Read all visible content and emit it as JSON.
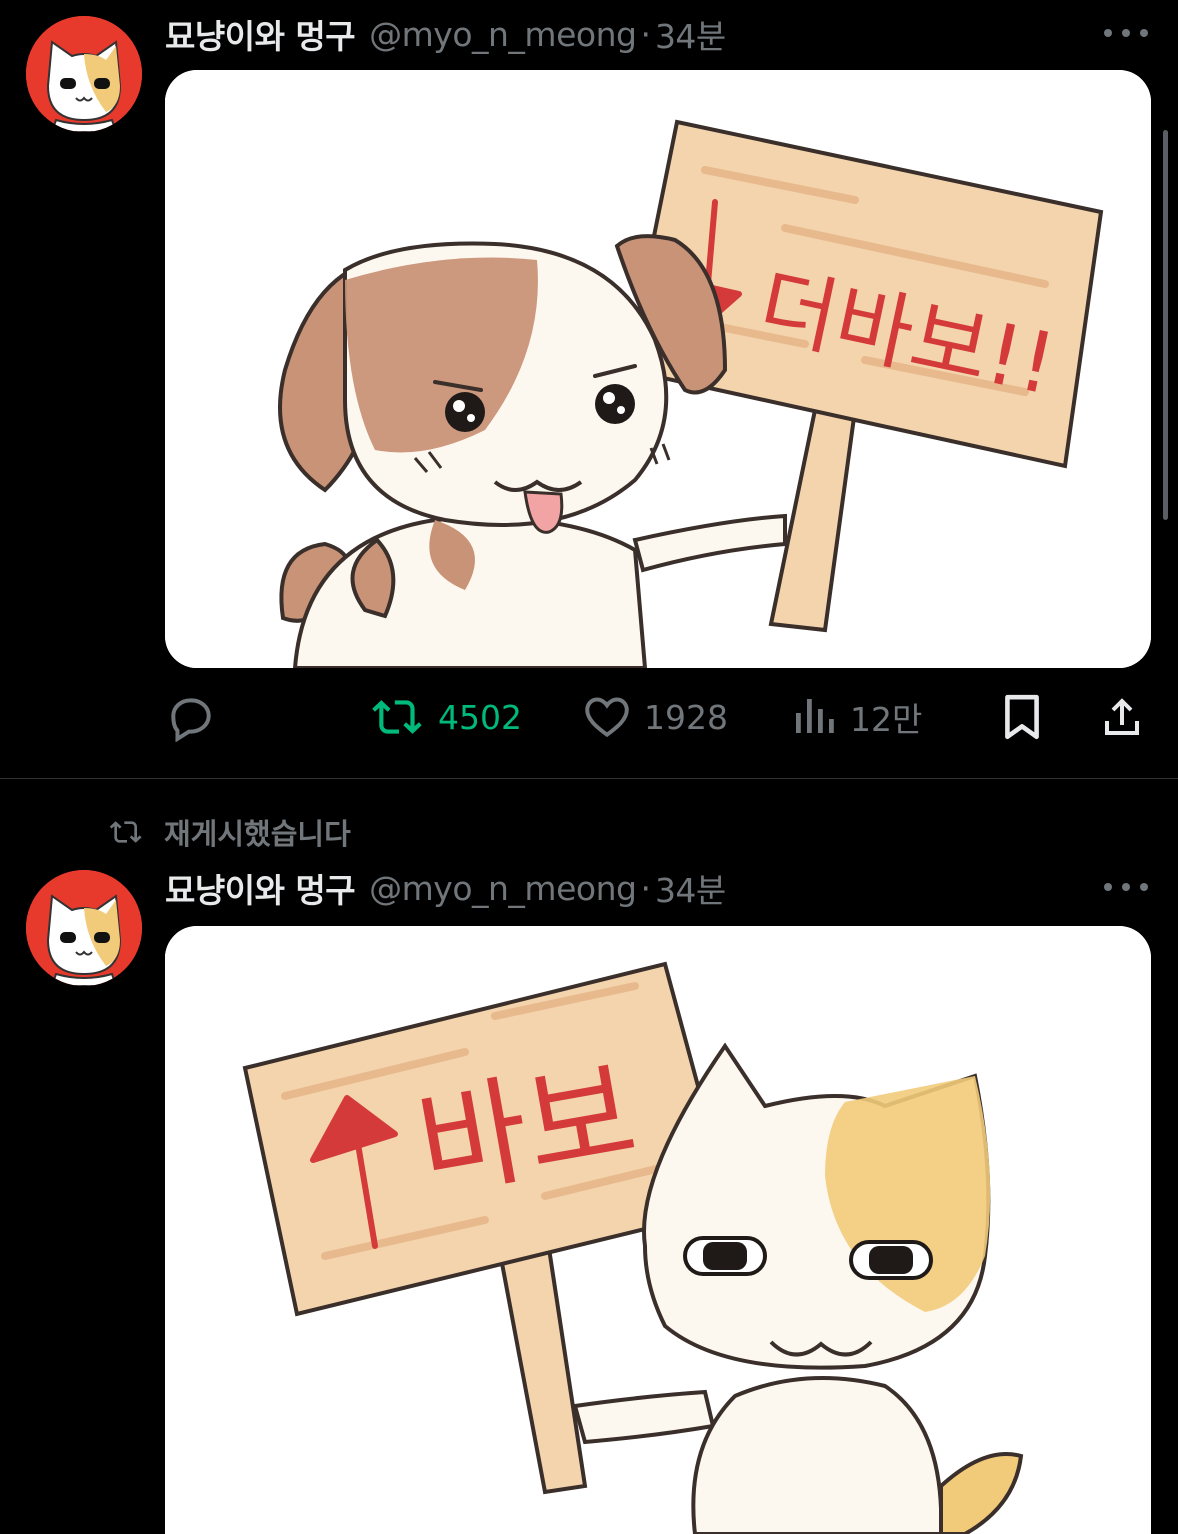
{
  "tweets": [
    {
      "author": {
        "display_name": "묘냥이와 멍구",
        "handle": "@myo_n_meong"
      },
      "separator": "·",
      "time": "34분",
      "media": {
        "sign_text": "더바보!!",
        "sign_arrow": "down-arrow",
        "character": "puppy"
      },
      "actions": {
        "reply": {
          "icon": "reply-icon"
        },
        "retweet": {
          "icon": "retweet-icon",
          "count": "4502",
          "active": true,
          "color": "#00ba7c"
        },
        "like": {
          "icon": "heart-icon",
          "count": "1928"
        },
        "views": {
          "icon": "views-icon",
          "count": "12만"
        },
        "bookmark": {
          "icon": "bookmark-icon"
        },
        "share": {
          "icon": "share-icon"
        }
      }
    },
    {
      "repost_label": "재게시했습니다",
      "author": {
        "display_name": "묘냥이와 멍구",
        "handle": "@myo_n_meong"
      },
      "separator": "·",
      "time": "34분",
      "media": {
        "sign_text": "바보",
        "sign_arrow": "up-arrow",
        "character": "cat"
      }
    }
  ],
  "colors": {
    "background": "#000000",
    "text": "#e7e9ea",
    "muted": "#71767b",
    "avatar_bg": "#e83a2c"
  }
}
